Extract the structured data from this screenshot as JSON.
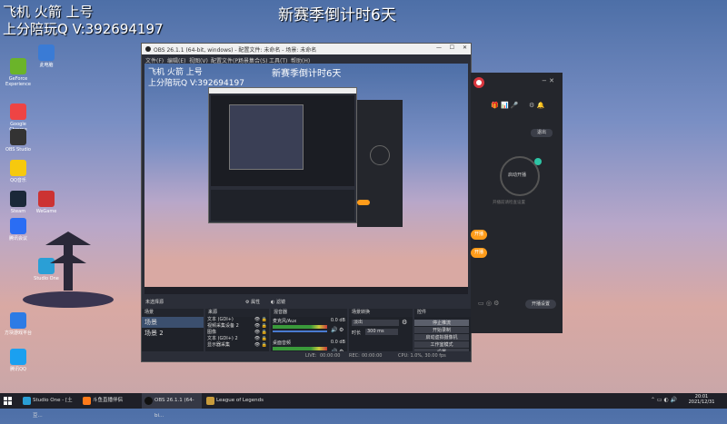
{
  "overlay": {
    "streamer_line1": "飞机 火箭 上号",
    "streamer_line2": "上分陪玩Q V:392694197",
    "season_countdown": "新赛季倒计时6天"
  },
  "obs": {
    "title": "OBS 26.1.1 (64-bit, windows) - 配置文件: 未命名 - 场景: 未命名",
    "menu": [
      "文件(F)",
      "编辑(E)",
      "视图(V)",
      "配置文件(P)",
      "场景集合(S)",
      "工具(T)",
      "帮助(H)"
    ],
    "preview_line1": "飞机 火箭 上号",
    "preview_line2": "上分陪玩Q V:392694197",
    "preview_season": "新赛季倒计时6天",
    "scene_bar": {
      "label": "未选择源",
      "properties": "属性",
      "filters": "滤镜"
    },
    "docks": {
      "scenes": {
        "title": "场景",
        "items": [
          "场景",
          "场景 2"
        ]
      },
      "sources": {
        "title": "来源",
        "items": [
          "文本 (GDI+)",
          "视频采集设备 2",
          "图像",
          "文本 (GDI+) 2",
          "显示器采集"
        ]
      },
      "mixer": {
        "title": "混音器",
        "channels": [
          {
            "name": "麦克风/Aux",
            "value": "0.0 dB"
          },
          {
            "name": "桌面音频",
            "value": "0.0 dB"
          }
        ]
      },
      "transitions": {
        "title": "场景转换",
        "type": "淡出",
        "duration_label": "时长",
        "duration": "300 ms"
      },
      "controls": {
        "title": "控件",
        "buttons": [
          "停止推流",
          "开始录制",
          "启动虚拟摄像机",
          "工作室模式",
          "设置",
          "退出"
        ]
      }
    },
    "status": {
      "live": "LIVE:",
      "live_time": "00:00:00",
      "rec": "REC:",
      "rec_time": "00:00:00",
      "cpu": "CPU: 1.0%, 30.00 fps"
    }
  },
  "desktop_icons": [
    {
      "label": "GeForce Experience",
      "color": "#6bb42a"
    },
    {
      "label": "此电脑",
      "color": "#3a7bd5"
    },
    {
      "label": "Google Chrome",
      "color": "#e44"
    },
    {
      "label": "OBS Studio",
      "color": "#333"
    },
    {
      "label": "QQ音乐",
      "color": "#f6c90e"
    },
    {
      "label": "Steam",
      "color": "#1b2838"
    },
    {
      "label": "WeGame",
      "color": "#c33"
    },
    {
      "label": "腾讯会议",
      "color": "#2a6df4"
    },
    {
      "label": "Studio One",
      "color": "#2a9fd6"
    },
    {
      "label": "方块游戏平台",
      "color": "#2c7be5"
    },
    {
      "label": "腾讯QQ",
      "color": "#1aa0f0"
    }
  ],
  "app": {
    "start_live": "启动开播",
    "stop_live": "退出",
    "hint": "开播前请检查设置",
    "bottom_btn": "开播设置",
    "pills": [
      "开播",
      "开播"
    ]
  },
  "taskbar": {
    "items": [
      "Studio One - [土豆...",
      "斗鱼直播伴侣",
      "OBS 26.1.1 (64-bi...",
      "League of Legends"
    ],
    "time": "20:01",
    "date": "2021/12/31"
  }
}
